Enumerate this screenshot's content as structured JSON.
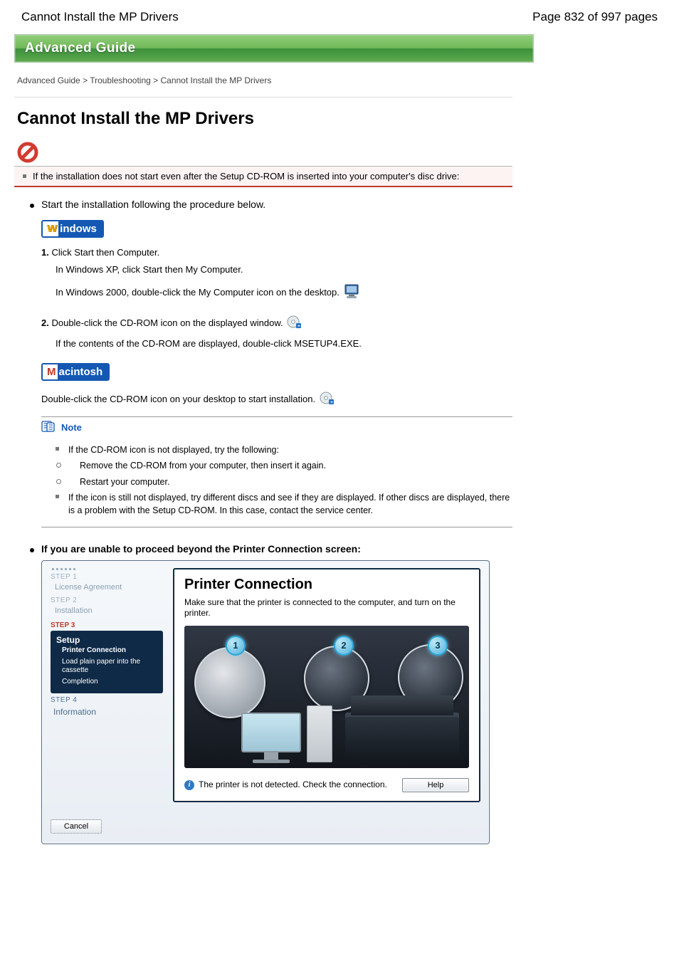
{
  "header": {
    "title_left": "Cannot Install the MP Drivers",
    "title_right": "Page 832 of 997 pages"
  },
  "banner": {
    "label": "Advanced Guide"
  },
  "breadcrumb": "Advanced Guide > Troubleshooting > Cannot Install the MP Drivers",
  "h1": "Cannot Install the MP Drivers",
  "section_bar": "If the installation does not start even after the Setup CD-ROM is inserted into your computer's disc drive:",
  "bullets": {
    "start_install": "Start the installation following the procedure below.",
    "win1": "Click Start then Computer.",
    "win1_sub": "In Windows XP, click Start then My Computer.",
    "win1_2k": "In Windows 2000, double-click the My Computer icon on the desktop.",
    "win2": "Double-click the CD-ROM icon on the displayed window.",
    "after_cd": "If the contents of the CD-ROM are displayed, double-click MSETUP4.EXE.",
    "mac1": "Double-click the CD-ROM icon on your desktop to start installation.",
    "note_head": "Note",
    "note_items": {
      "a": "If the CD-ROM icon is not displayed, try the following:",
      "a1": "Remove the CD-ROM from your computer, then insert it again.",
      "a2": "Restart your computer.",
      "b": "If the icon is still not displayed, try different discs and see if they are displayed. If other discs are displayed, there is a problem with the Setup CD-ROM. In this case, contact the service center."
    },
    "stuck": "If you are unable to proceed beyond the Printer Connection screen:"
  },
  "os_badges": {
    "win_lead": "W",
    "win_rest": "indows",
    "mac_lead": "M",
    "mac_rest": "acintosh"
  },
  "dialog": {
    "side": {
      "step1_lbl": "STEP 1",
      "step1_item": "License Agreement",
      "step2_lbl": "STEP 2",
      "step2_item": "Installation",
      "step3_lbl": "STEP 3",
      "setup_title": "Setup",
      "setup_sub1": "Printer Connection",
      "setup_sub2": "Load plain paper into the cassette",
      "setup_sub3": "Completion",
      "step4_lbl": "STEP 4",
      "step4_item": "Information"
    },
    "main": {
      "title": "Printer Connection",
      "desc": "Make sure that the printer is connected to the computer, and turn on the printer.",
      "badge1": "1",
      "badge2": "2",
      "badge3": "3",
      "status_msg": "The printer is not detected. Check the connection.",
      "help_btn": "Help",
      "cancel_btn": "Cancel"
    }
  }
}
